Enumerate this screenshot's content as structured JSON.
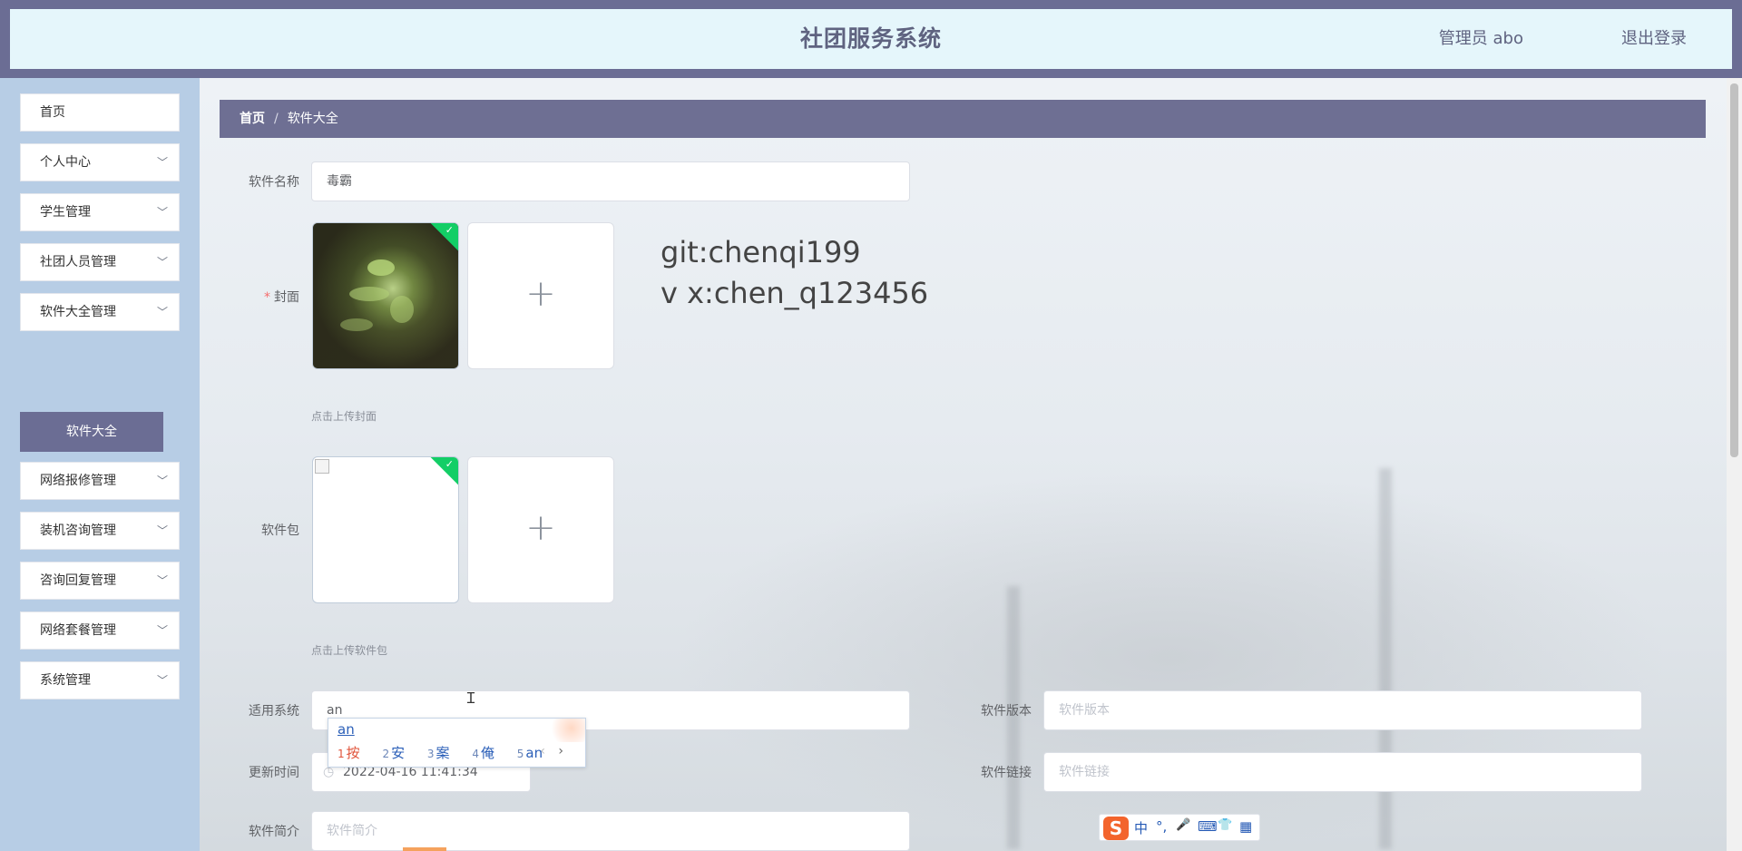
{
  "header": {
    "title": "社团服务系统",
    "user": "管理员 abo",
    "logout": "退出登录"
  },
  "sidebar": {
    "items": [
      {
        "label": "首页",
        "has_arrow": false
      },
      {
        "label": "个人中心",
        "has_arrow": true
      },
      {
        "label": "学生管理",
        "has_arrow": true
      },
      {
        "label": "社团人员管理",
        "has_arrow": true
      },
      {
        "label": "软件大全管理",
        "has_arrow": true
      },
      {
        "label": "网络报修管理",
        "has_arrow": true
      },
      {
        "label": "装机咨询管理",
        "has_arrow": true
      },
      {
        "label": "咨询回复管理",
        "has_arrow": true
      },
      {
        "label": "网络套餐管理",
        "has_arrow": true
      },
      {
        "label": "系统管理",
        "has_arrow": true
      }
    ],
    "active_sub": "软件大全"
  },
  "breadcrumb": {
    "home": "首页",
    "separator": "/",
    "current": "软件大全"
  },
  "form": {
    "name_label": "软件名称",
    "name_value": "毒霸",
    "cover_label": "封面",
    "cover_required": "*",
    "cover_tip": "点击上传封面",
    "package_label": "软件包",
    "package_tip": "点击上传软件包",
    "system_label": "适用系统",
    "system_value": "an",
    "version_label": "软件版本",
    "version_placeholder": "软件版本",
    "time_label": "更新时间",
    "time_value": "2022-04-16 11:41:34",
    "link_label": "软件链接",
    "link_placeholder": "软件链接",
    "intro_label": "软件简介",
    "intro_placeholder": "软件简介"
  },
  "watermark": {
    "line1": "git:chenqi199",
    "line2": "v x:chen_q123456"
  },
  "ime": {
    "pinyin": "an",
    "candidates": [
      {
        "n": "1",
        "text": "按"
      },
      {
        "n": "2",
        "text": "安"
      },
      {
        "n": "3",
        "text": "案"
      },
      {
        "n": "4",
        "text": "俺"
      },
      {
        "n": "5",
        "text": "an"
      }
    ],
    "prev": "‹",
    "next": "›"
  },
  "sogou_toolbar": {
    "logo": "S",
    "items": [
      "中",
      "°,",
      "🎤",
      "⌨",
      "👕",
      "▦"
    ]
  },
  "colors": {
    "header_bg": "#6b6d94",
    "header_inner": "#e5f6fb",
    "sidebar_bg": "#b7cde5",
    "accent": "#6e6f93",
    "success": "#13ce66"
  }
}
